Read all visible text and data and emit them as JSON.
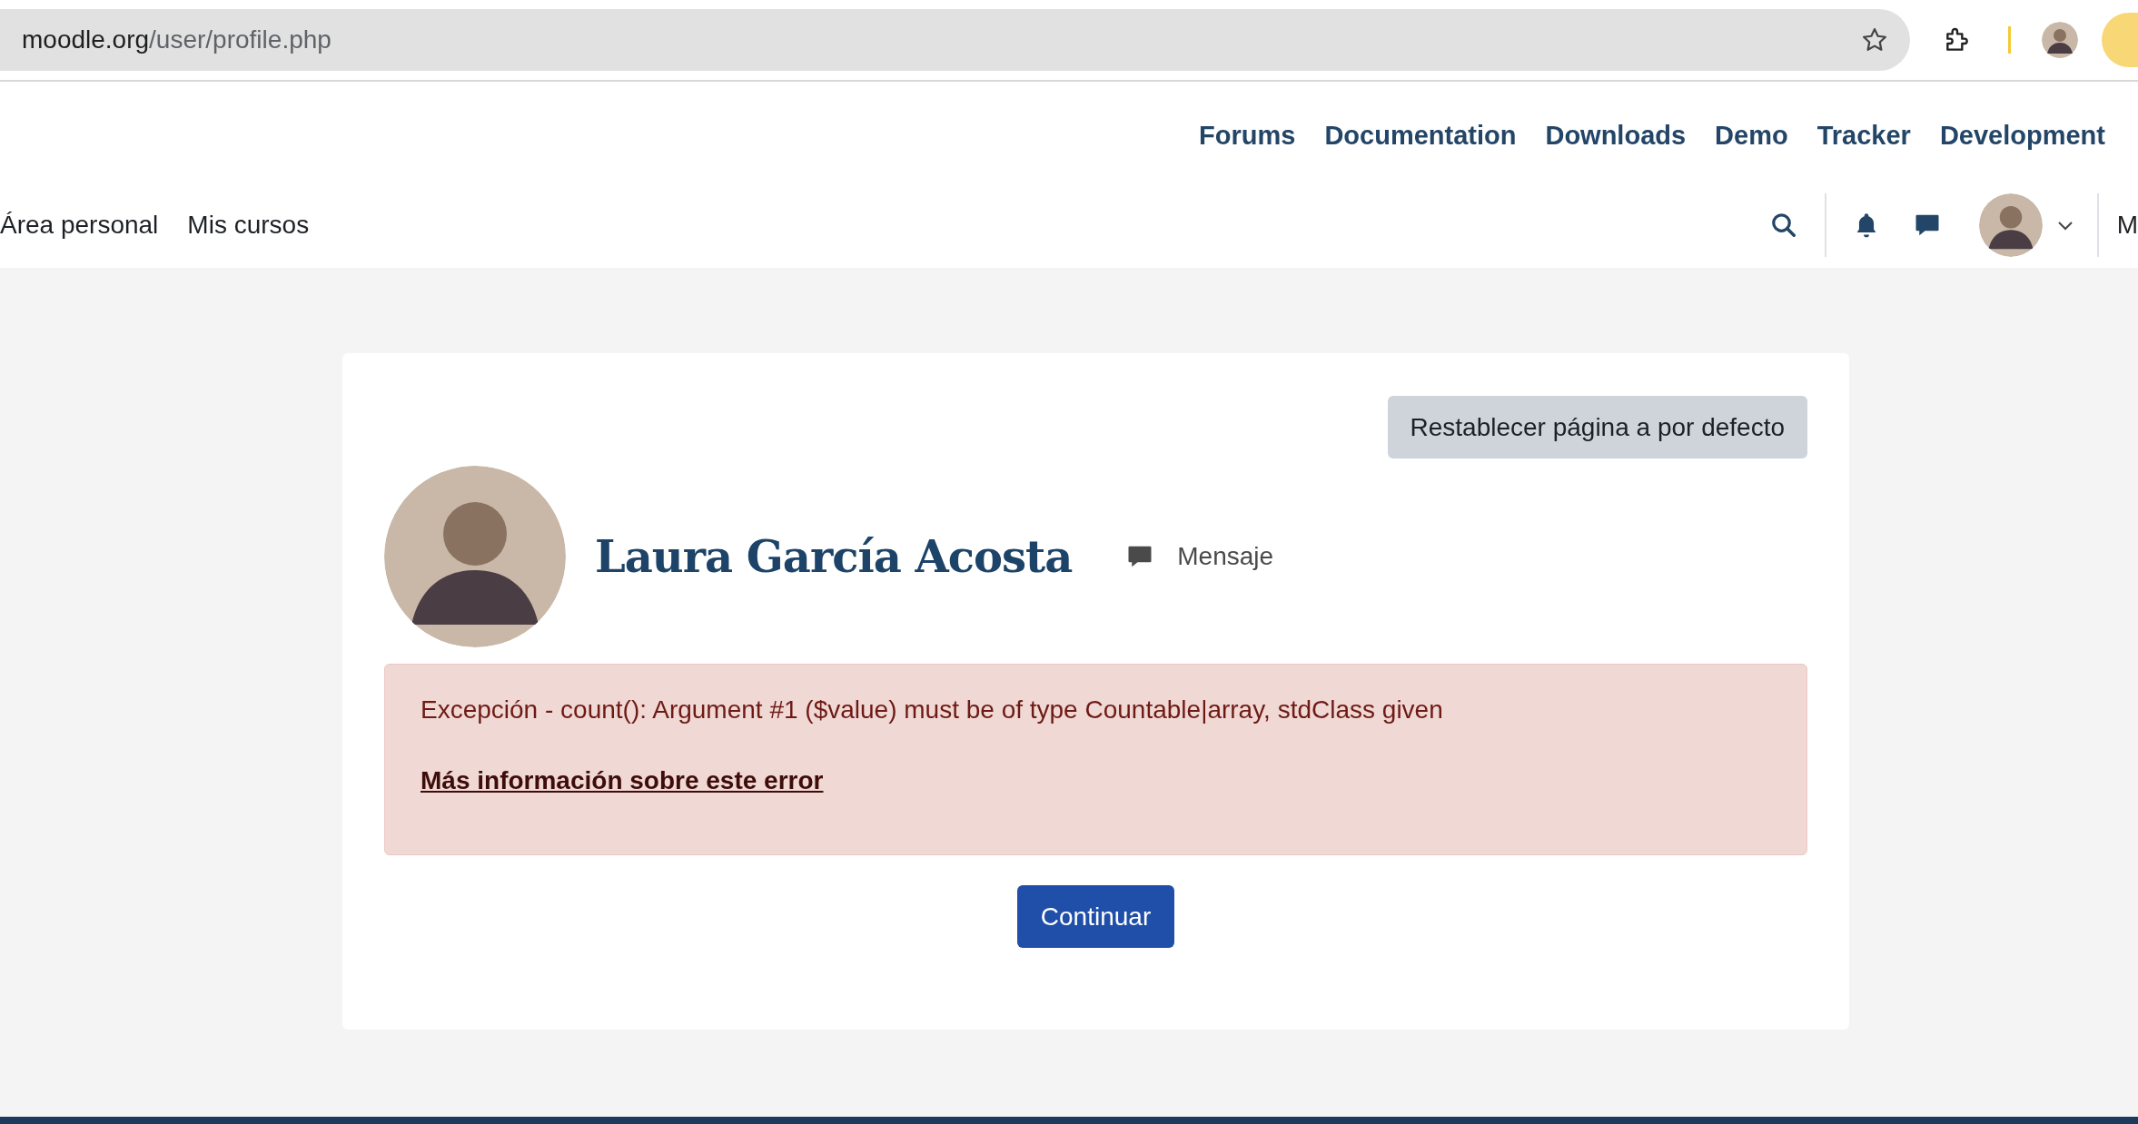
{
  "browser": {
    "url_host": "moodle.org",
    "url_path": "/user/profile.php"
  },
  "site_nav": {
    "items": [
      "Forums",
      "Documentation",
      "Downloads",
      "Demo",
      "Tracker",
      "Development"
    ]
  },
  "course_nav": {
    "items": [
      "Área personal",
      "Mis cursos"
    ],
    "edge_text": "M"
  },
  "profile": {
    "reset_button": "Restablecer página a por defecto",
    "name": "Laura García Acosta",
    "message_link": "Mensaje"
  },
  "error": {
    "message": "Excepción - count(): Argument #1 ($value) must be of type Countable|array, stdClass given",
    "more_info_link": "Más información sobre este error"
  },
  "continue_button": "Continuar"
}
